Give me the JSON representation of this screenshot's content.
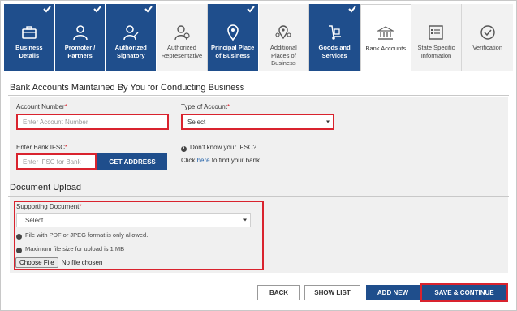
{
  "tabs": [
    {
      "label": "Business Details",
      "state": "done",
      "icon": "briefcase-icon"
    },
    {
      "label": "Promoter / Partners",
      "state": "done",
      "icon": "person-icon"
    },
    {
      "label": "Authorized Signatory",
      "state": "done",
      "icon": "signatory-icon"
    },
    {
      "label": "Authorized Representative",
      "state": "pending",
      "icon": "representative-icon"
    },
    {
      "label": "Principal Place of Business",
      "state": "done",
      "icon": "location-pin-icon"
    },
    {
      "label": "Additional Places of Business",
      "state": "pending",
      "icon": "multi-location-icon"
    },
    {
      "label": "Goods and Services",
      "state": "done",
      "icon": "hand-truck-icon"
    },
    {
      "label": "Bank Accounts",
      "state": "active",
      "icon": "bank-icon"
    },
    {
      "label": "State Specific Information",
      "state": "pending",
      "icon": "document-list-icon"
    },
    {
      "label": "Verification",
      "state": "pending",
      "icon": "check-circle-icon"
    }
  ],
  "bank_section": {
    "title": "Bank Accounts Maintained By You for Conducting Business",
    "account_number_label": "Account Number",
    "account_number_placeholder": "Enter Account Number",
    "account_type_label": "Type of Account",
    "account_type_value": "Select",
    "ifsc_label": "Enter Bank IFSC",
    "ifsc_placeholder": "Enter IFSC for Bank",
    "get_address_label": "GET ADDRESS",
    "dont_know_text": "Don't know your IFSC?",
    "click_text": "Click",
    "here_link": "here",
    "find_text": "to find your bank"
  },
  "document_section": {
    "title": "Document Upload",
    "supporting_label": "Supporting Document",
    "supporting_value": "Select",
    "note_format": "File with PDF or JPEG format is only allowed.",
    "note_size": "Maximum file size for upload is 1 MB",
    "choose_file_label": "Choose File",
    "no_file_text": "No file chosen"
  },
  "footer": {
    "back_label": "BACK",
    "show_list_label": "SHOW LIST",
    "add_new_label": "ADD NEW",
    "save_continue_label": "SAVE & CONTINUE"
  },
  "colors": {
    "primary": "#1f4e8c",
    "highlight": "#d9232e"
  }
}
